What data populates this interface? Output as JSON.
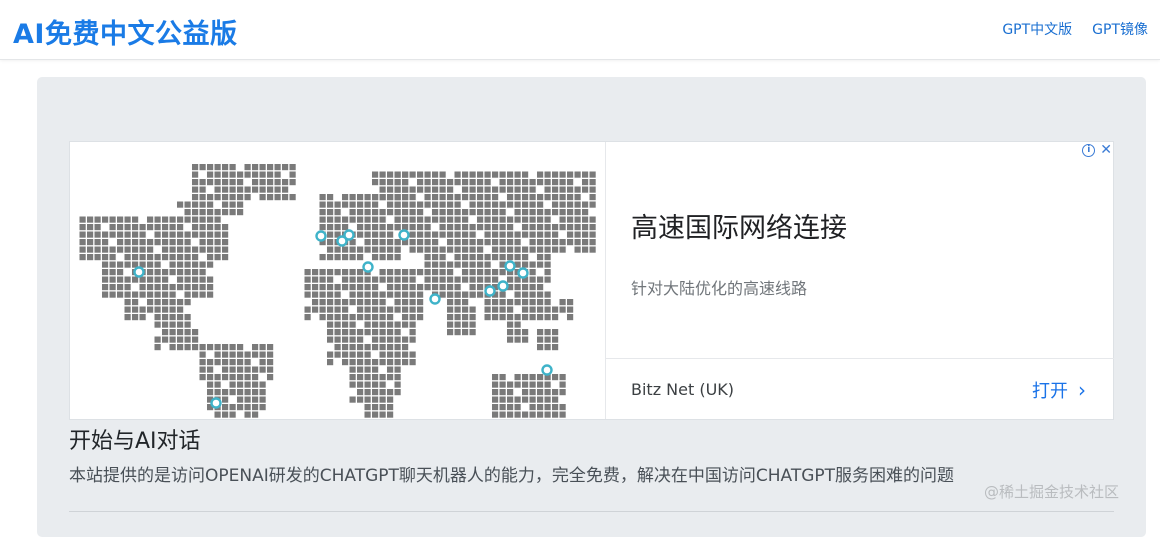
{
  "header": {
    "brand": "AI免费中文公益版",
    "nav": [
      {
        "label": "GPT中文版"
      },
      {
        "label": "GPT镜像"
      }
    ]
  },
  "ad": {
    "headline": "高速国际网络连接",
    "subtext": "针对大陆优化的高速线路",
    "advertiser": "Bitz Net (UK)",
    "open_label": "打开",
    "info_icon": "info-icon",
    "close_icon": "close-icon",
    "colors": {
      "map_land": "#7a7a7a",
      "map_marker": "#3fb3c9",
      "link": "#1a73e8"
    }
  },
  "main": {
    "title": "开始与AI对话",
    "description": "本站提供的是访问OPENAI研发的CHATGPT聊天机器人的能力，完全免费，解决在中国访问CHATGPT服务困难的问题"
  },
  "watermark": "@稀土掘金技术社区"
}
